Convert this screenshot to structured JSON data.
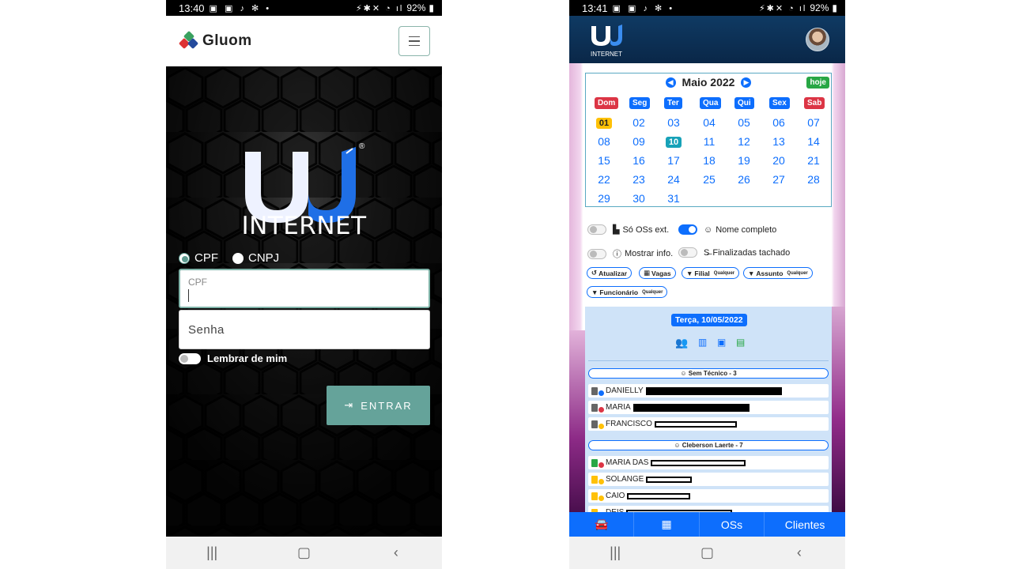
{
  "left": {
    "status": {
      "time": "13:40",
      "battery": "92%"
    },
    "header": {
      "brand": "Gluom"
    },
    "logo": {
      "wordmark": "INTERNET",
      "reg": "®"
    },
    "doc_type": {
      "options": [
        "CPF",
        "CNPJ"
      ],
      "selected": "CPF"
    },
    "cpf_field": {
      "label": "CPF",
      "value": ""
    },
    "senha_field": {
      "placeholder": "Senha"
    },
    "remember_label": "Lembrar de mim",
    "submit_label": "ENTRAR"
  },
  "right": {
    "status": {
      "time": "13:41",
      "battery": "92%"
    },
    "header": {
      "logo_text": "INTERNET"
    },
    "calendar": {
      "title": "Maio 2022",
      "today_label": "hoje",
      "weekdays": [
        "Dom",
        "Seg",
        "Ter",
        "Qua",
        "Qui",
        "Sex",
        "Sab"
      ],
      "weeks": [
        [
          "01",
          "02",
          "03",
          "04",
          "05",
          "06",
          "07"
        ],
        [
          "08",
          "09",
          "10",
          "11",
          "12",
          "13",
          "14"
        ],
        [
          "15",
          "16",
          "17",
          "18",
          "19",
          "20",
          "21"
        ],
        [
          "22",
          "23",
          "24",
          "25",
          "26",
          "27",
          "28"
        ],
        [
          "29",
          "30",
          "31"
        ]
      ]
    },
    "options": {
      "so_oss_ext": {
        "label": "Só OSs ext.",
        "on": false
      },
      "nome_completo": {
        "label": "Nome completo",
        "on": true
      },
      "mostrar_info": {
        "label": "Mostrar info.",
        "on": false
      },
      "finalizadas": {
        "label": "Finalizadas tachado",
        "on": false
      }
    },
    "filters": {
      "atualizar": "Atualizar",
      "vagas": "Vagas",
      "filial": "Filial",
      "assunto": "Assunto",
      "funcionario": "Funcionário",
      "qualquer": "Qualquer"
    },
    "day": {
      "title": "Terça, 10/05/2022"
    },
    "groups": [
      {
        "title": "Sem Técnico - 3",
        "rows": [
          "DANIELLY",
          "MARIA",
          "FRANCISCO"
        ]
      },
      {
        "title": "Cleberson Laerte - 7",
        "rows": [
          "MARIA DAS",
          "SOLANGE",
          "CAIO",
          "DEIS"
        ]
      }
    ],
    "tabs": {
      "oss": "OSs",
      "clientes": "Clientes"
    }
  },
  "colors": {
    "gluom_green": "#65a39a",
    "primary": "#0d6efd",
    "danger": "#dc3545",
    "success": "#28a745",
    "header_navy": "#0f3a63"
  }
}
